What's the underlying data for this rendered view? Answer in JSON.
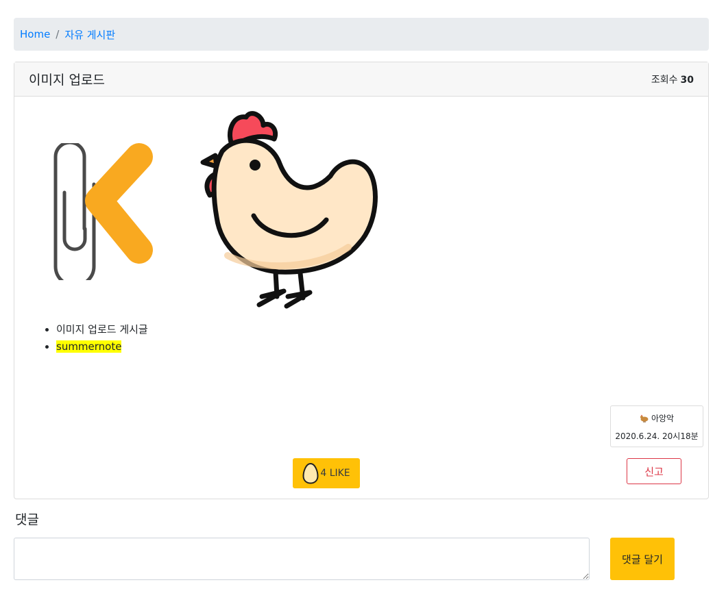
{
  "breadcrumb": {
    "home": "Home",
    "separator": "/",
    "board": "자유 게시판"
  },
  "post": {
    "title": "이미지 업로드",
    "views_label": "조회수",
    "views_count": "30",
    "list_items": [
      "이미지 업로드 게시글",
      "summernote"
    ],
    "author": "아앙악",
    "date": "2020.6.24. 20시18분",
    "like_label": "4 LIKE",
    "report_label": "신고"
  },
  "comments": {
    "heading": "댓글",
    "submit_label": "댓글 달기",
    "input_value": ""
  },
  "colors": {
    "accent": "#ffc107",
    "link": "#007bff",
    "danger": "#dc3545",
    "highlight": "#ffff00",
    "logo_orange": "#f9a920"
  },
  "icons": [
    "paperclip-k-logo",
    "chicken-illustration",
    "egg-icon",
    "chicken-emoji-icon"
  ]
}
